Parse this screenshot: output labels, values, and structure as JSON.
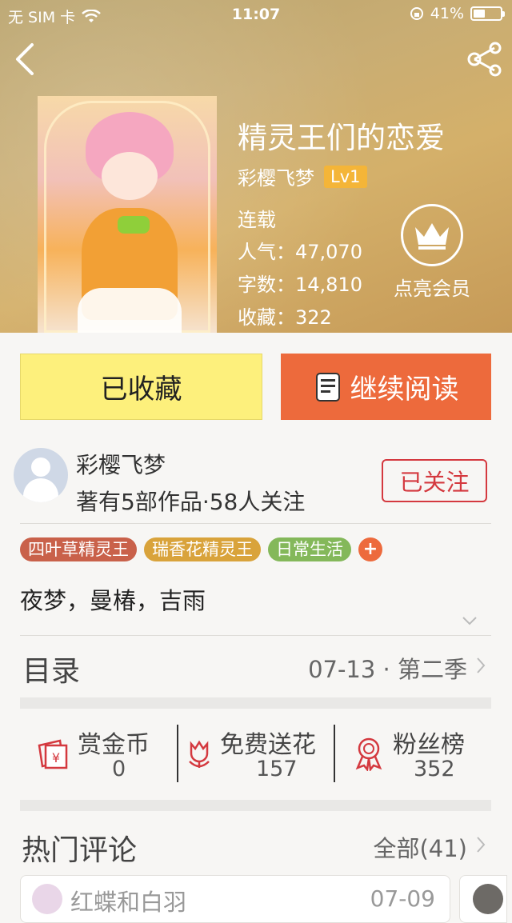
{
  "status_bar": {
    "carrier": "无 SIM 卡",
    "time": "11:07",
    "battery": "41%",
    "battery_level": 0.41
  },
  "book": {
    "title": "精灵王们的恋爱",
    "author": "彩樱飞梦",
    "level": "Lv1",
    "status": "连载",
    "popularity": "人气：47,070",
    "word_count": "字数：14,810",
    "favorites": "收藏：322"
  },
  "vip": {
    "label": "点亮会员"
  },
  "actions": {
    "fav_label": "已收藏",
    "read_label": "继续阅读"
  },
  "author_info": {
    "name": "彩樱飞梦",
    "stats": "著有5部作品·58人关注",
    "follow_label": "已关注"
  },
  "tags": [
    {
      "label": "四叶草精灵王",
      "color": "#c9614a"
    },
    {
      "label": "瑞香花精灵王",
      "color": "#d9a33b"
    },
    {
      "label": "日常生活",
      "color": "#84b85a"
    }
  ],
  "tag_add": "+",
  "description": "夜梦，曼椿，吉雨",
  "toc": {
    "label": "目录",
    "latest": "07-13 · 第二季"
  },
  "stats": {
    "coins_label": "赏金币",
    "coins_value": "0",
    "flowers_label": "免费送花",
    "flowers_value": "157",
    "fans_label": "粉丝榜",
    "fans_value": "352"
  },
  "comments": {
    "label": "热门评论",
    "all": "全部(41)",
    "first": {
      "user": "红蝶和白羽",
      "date": "07-09"
    }
  },
  "colors": {
    "accent": "#ed6a3c",
    "fav_yellow": "#fdf07c",
    "follow_red": "#d4393f"
  }
}
